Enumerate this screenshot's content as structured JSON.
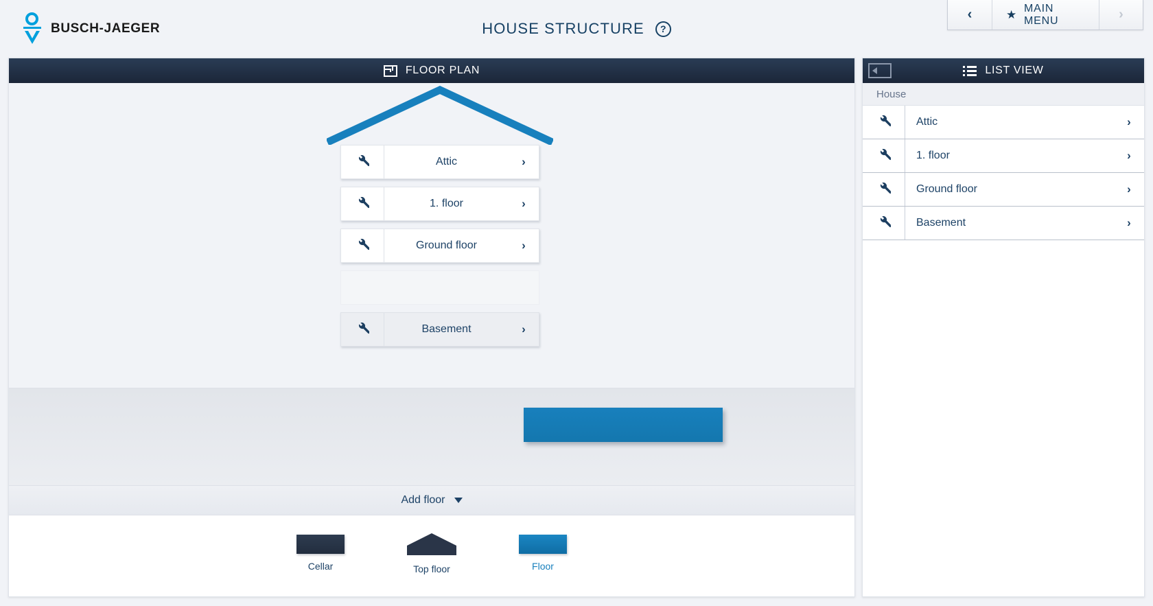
{
  "brand": {
    "name": "BUSCH-JAEGER"
  },
  "header": {
    "title": "HOUSE STRUCTURE",
    "help_label": "?",
    "menu": {
      "back_label": "‹",
      "main_menu_label": "MAIN MENU",
      "forward_label": "›",
      "star_glyph": "★"
    }
  },
  "floor_panel": {
    "header_title": "FLOOR PLAN",
    "floors": [
      {
        "label": "Attic",
        "chevron": "›",
        "icon": "wrench-icon",
        "style": "white"
      },
      {
        "label": "1. floor",
        "chevron": "›",
        "icon": "wrench-icon",
        "style": "white"
      },
      {
        "label": "Ground floor",
        "chevron": "›",
        "icon": "wrench-icon",
        "style": "white"
      },
      {
        "label": "Basement",
        "chevron": "›",
        "icon": "wrench-icon",
        "style": "grey"
      }
    ],
    "drop_slot": {
      "label": ""
    },
    "drag_block": {
      "label": ""
    },
    "add_floor": {
      "label": "Add floor",
      "chevron": "chevron-down-icon"
    },
    "palette": [
      {
        "label": "Cellar",
        "swatch": "rect-dark",
        "active": false
      },
      {
        "label": "Top floor",
        "swatch": "roof-dark",
        "active": false
      },
      {
        "label": "Floor",
        "swatch": "rect-blue",
        "active": true
      }
    ]
  },
  "list_panel": {
    "header_title": "LIST VIEW",
    "collapse_icon": "collapse-panel-icon",
    "breadcrumb": "House",
    "rows": [
      {
        "label": "Attic",
        "chevron": "›",
        "icon": "wrench-icon"
      },
      {
        "label": "1. floor",
        "chevron": "›",
        "icon": "wrench-icon"
      },
      {
        "label": "Ground floor",
        "chevron": "›",
        "icon": "wrench-icon"
      },
      {
        "label": "Basement",
        "chevron": "›",
        "icon": "wrench-icon"
      }
    ]
  },
  "colors": {
    "accent_blue": "#1880bd",
    "brand_cyan": "#00a0dd",
    "dark_navy": "#1d4266",
    "header_gradient_top": "#2a3c55",
    "header_gradient_bottom": "#1b2638"
  }
}
